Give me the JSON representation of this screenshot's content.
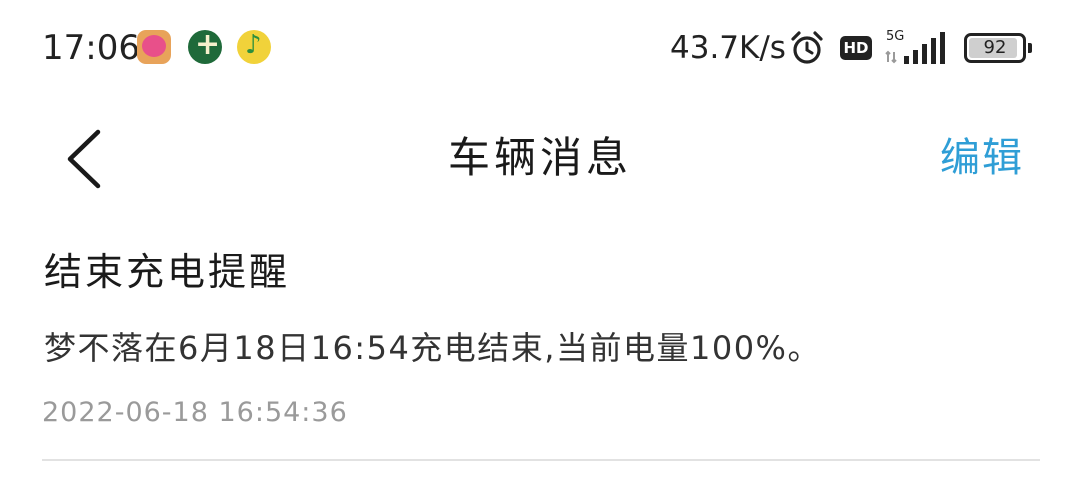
{
  "status_bar": {
    "time": "17:06",
    "app_icons": [
      "notification-app-icon",
      "game-app-icon",
      "music-app-icon"
    ],
    "net_speed": "43.7K/s",
    "hd_label": "HD",
    "network_type": "5G",
    "battery_level": "92",
    "battery_fraction": 0.92
  },
  "nav": {
    "title": "车辆消息",
    "edit_label": "编辑",
    "accent_color": "#2f9ed6"
  },
  "messages": [
    {
      "title": "结束充电提醒",
      "body": "梦不落在6月18日16:54充电结束,当前电量100%。",
      "timestamp": "2022-06-18 16:54:36"
    }
  ]
}
